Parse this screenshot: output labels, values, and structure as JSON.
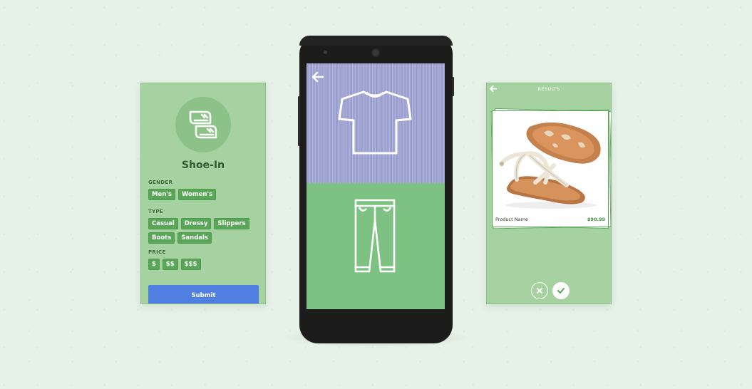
{
  "left_card": {
    "app_title": "Shoe-In",
    "gender": {
      "label": "GENDER",
      "options": [
        "Men's",
        "Women's"
      ]
    },
    "type": {
      "label": "TYPE",
      "options": [
        "Casual",
        "Dressy",
        "Slippers",
        "Boots",
        "Sandals"
      ]
    },
    "price": {
      "label": "PRICE",
      "options": [
        "$",
        "$$",
        "$$$"
      ]
    },
    "submit_label": "Submit"
  },
  "phone": {
    "top_icon": "tshirt-icon",
    "bottom_icon": "pants-icon"
  },
  "right_card": {
    "title": "RESULTS",
    "product": {
      "name": "Product Name",
      "price": "$90.99",
      "image": "sandal-photo"
    }
  },
  "colors": {
    "background": "#e6f1e8",
    "card_green": "#a5d2a0",
    "chip_green": "#5aa659",
    "submit_blue": "#4f7fe0",
    "shirt_panel": "#9fa3d1",
    "pants_panel": "#7ec283"
  }
}
